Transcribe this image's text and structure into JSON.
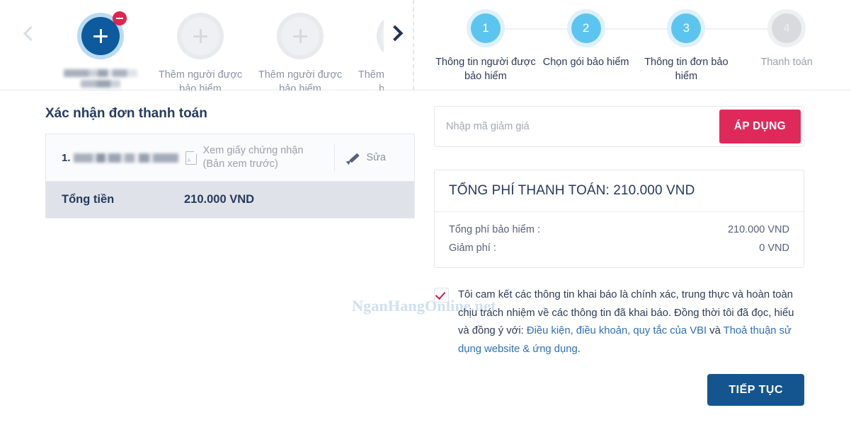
{
  "carousel": {
    "prev_icon": "chevron-left-icon",
    "next_icon": "chevron-right-icon",
    "cards": [
      {
        "label": "",
        "redacted": true,
        "state": "selected",
        "badge": "minus-badge"
      },
      {
        "label": "Thêm người được bảo hiểm",
        "redacted": false,
        "state": "empty"
      },
      {
        "label": "Thêm người được bảo hiểm",
        "redacted": false,
        "state": "empty"
      },
      {
        "label": "Thêm người được bảo hiểm",
        "redacted": false,
        "state": "empty"
      }
    ]
  },
  "stepper": {
    "steps": [
      {
        "number": "1",
        "label": "Thông tin người được bảo hiểm",
        "active": true
      },
      {
        "number": "2",
        "label": "Chọn gói bảo hiểm",
        "active": true
      },
      {
        "number": "3",
        "label": "Thông tin đơn bảo hiểm",
        "active": true
      },
      {
        "number": "4",
        "label": "Thanh toán",
        "active": false
      }
    ]
  },
  "watermark": "NganHangOnline.net",
  "order": {
    "title": "Xác nhận đơn thanh toán",
    "row_index": "1.",
    "row_name": "",
    "cert_link_line1": "Xem giấy chứng nhận",
    "cert_link_line2": "(Bản xem trước)",
    "cert_icon": "pdf-document-icon",
    "edit_label": "Sửa",
    "edit_icon": "pencil-icon",
    "total_label": "Tổng tiền",
    "total_value": "210.000 VND"
  },
  "promo": {
    "placeholder": "Nhập mã giảm giá",
    "value": "",
    "apply_label": "ÁP DỤNG"
  },
  "fees": {
    "heading": "TỔNG PHÍ THANH TOÁN: 210.000 VND",
    "lines": [
      {
        "label": "Tổng phí bảo hiểm :",
        "value": "210.000 VND"
      },
      {
        "label": "Giảm phí :",
        "value": "0 VND"
      }
    ]
  },
  "terms": {
    "checked": true,
    "text_part1": "Tôi cam kết các thông tin khai báo là chính xác, trung thực và hoàn toàn chịu trách nhiệm về các thông tin đã khai báo. Đồng thời tôi đã đọc, hiểu và đồng ý với: ",
    "link1": "Điều kiện, điều khoản, quy tắc của VBI",
    "text_part2": " và ",
    "link2": "Thoả thuận sử dụng website & ứng dụng",
    "text_part3": "."
  },
  "actions": {
    "continue_label": "TIẾP TỤC"
  },
  "colors": {
    "primary_blue": "#15558f",
    "step_active": "#5cc5ef",
    "accent_pink": "#e0295b",
    "check_red": "#d4194f",
    "total_bg": "#dfe3e9"
  }
}
